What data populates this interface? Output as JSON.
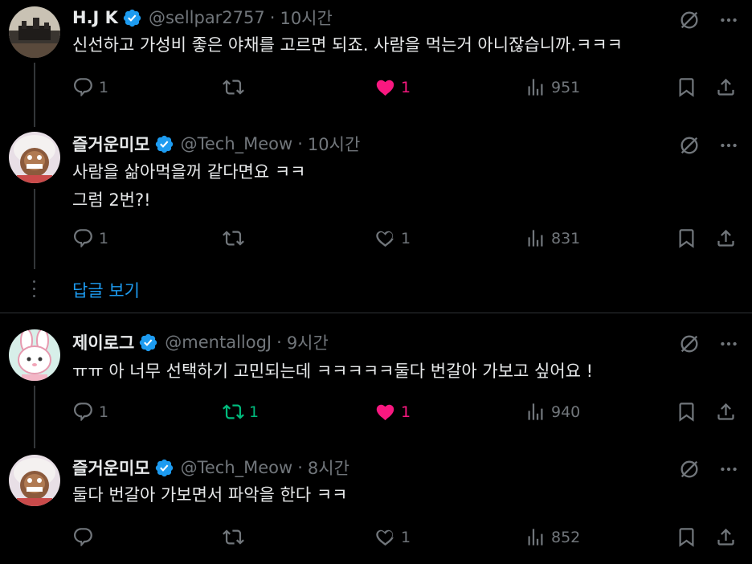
{
  "show_replies_label": "답글 보기",
  "colors": {
    "verified": "#1d9bf0",
    "like": "#f91880",
    "retweet": "#00ba7c",
    "muted": "#71767b"
  },
  "tweets": [
    {
      "name": "H.J K",
      "handle": "@sellpar2757",
      "dot": "·",
      "time": "10시간",
      "text": "신선하고 가성비 좋은 야채를 고르면 되죠. 사람을 먹는거 아니잖습니까.ㅋㅋㅋ",
      "replies": "1",
      "retweets": "",
      "likes": "1",
      "liked": true,
      "views": "951"
    },
    {
      "name": "즐거운미모",
      "handle": "@Tech_Meow",
      "dot": "·",
      "time": "10시간",
      "text": "사람을 삶아먹을꺼 같다면요 ㅋㅋ\n그럼 2번?!",
      "replies": "1",
      "retweets": "",
      "likes": "1",
      "liked": false,
      "views": "831"
    },
    {
      "name": "제이로그",
      "handle": "@mentallogJ",
      "dot": "·",
      "time": "9시간",
      "text": "ㅠㅠ 아 너무 선택하기 고민되는데 ㅋㅋㅋㅋㅋ둘다 번갈아 가보고 싶어요 !",
      "replies": "1",
      "retweets": "1",
      "likes": "1",
      "liked": true,
      "views": "940"
    },
    {
      "name": "즐거운미모",
      "handle": "@Tech_Meow",
      "dot": "·",
      "time": "8시간",
      "text": "둘다 번갈아 가보면서 파악을 한다 ㅋㅋ",
      "replies": "",
      "retweets": "",
      "likes": "1",
      "liked": false,
      "views": "852"
    }
  ]
}
